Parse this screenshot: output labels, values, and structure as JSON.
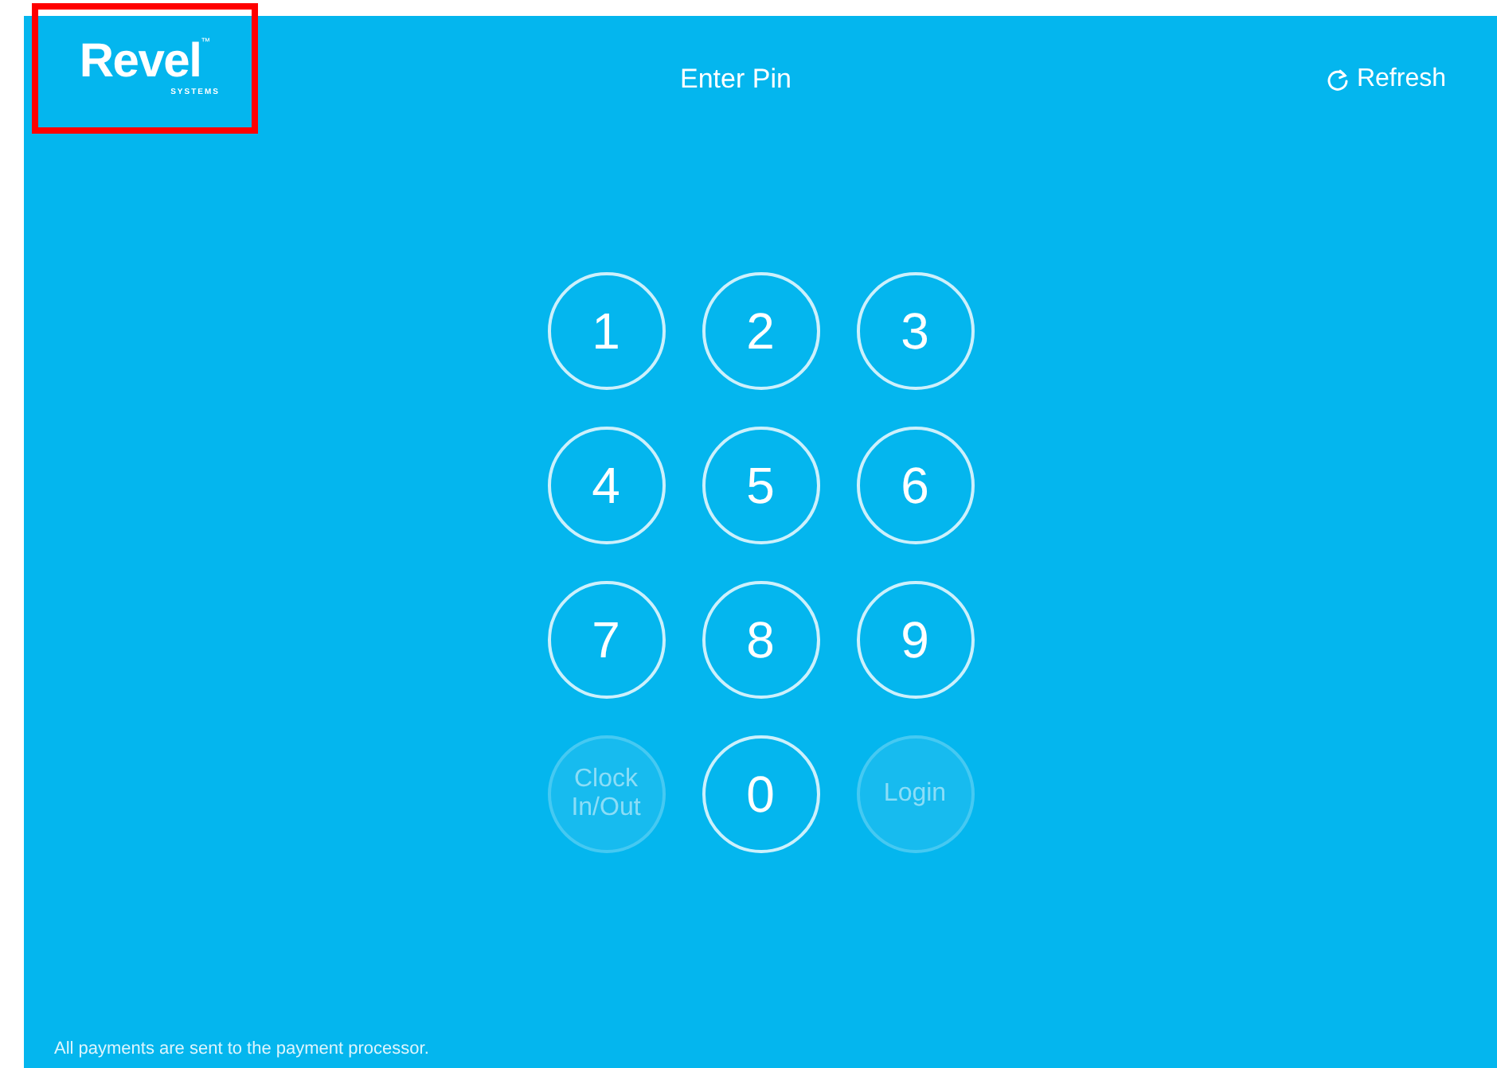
{
  "logo": {
    "wordmark": "Revel",
    "trademark": "™",
    "subtitle": "SYSTEMS",
    "highlighted": true
  },
  "header": {
    "title": "Enter Pin",
    "refresh": "Refresh"
  },
  "keypad": [
    {
      "label": "1",
      "disabled": false
    },
    {
      "label": "2",
      "disabled": false
    },
    {
      "label": "3",
      "disabled": false
    },
    {
      "label": "4",
      "disabled": false
    },
    {
      "label": "5",
      "disabled": false
    },
    {
      "label": "6",
      "disabled": false
    },
    {
      "label": "7",
      "disabled": false
    },
    {
      "label": "8",
      "disabled": false
    },
    {
      "label": "9",
      "disabled": false
    },
    {
      "label": "Clock In/Out",
      "disabled": true
    },
    {
      "label": "0",
      "disabled": false
    },
    {
      "label": "Login",
      "disabled": true
    }
  ],
  "footer": "All payments are sent to the payment processor."
}
